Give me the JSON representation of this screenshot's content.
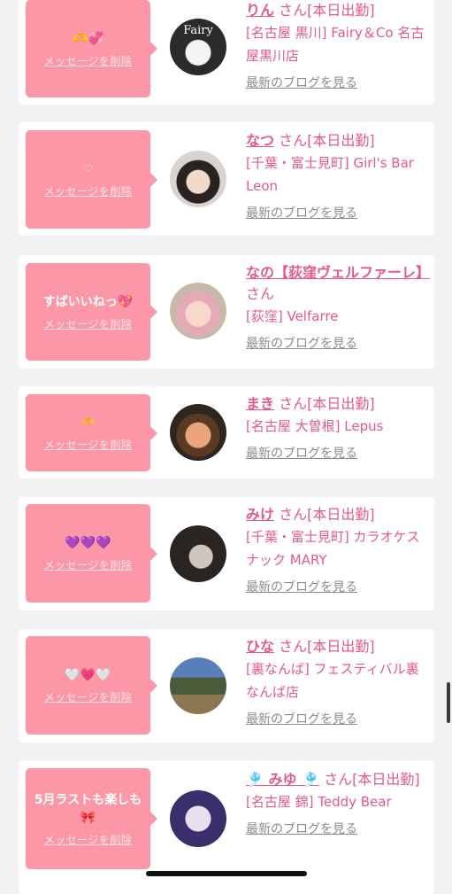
{
  "delete_label": "メッセージを削除",
  "blog_label": "最新のブログを見る",
  "san_label": "さん",
  "entries": [
    {
      "message": "🫶💞",
      "name": "りん",
      "status": "[本日出勤]",
      "shop": "[名古屋 黒川] Fairy＆Co 名古屋黒川店",
      "avatar_text": "Fairy"
    },
    {
      "message": "♡",
      "name": "なつ",
      "status": "[本日出勤]",
      "shop": "[千葉・富士見町] Girl's Bar Leon"
    },
    {
      "message": "すばいいねっ💖",
      "name": "なの【荻窪ヴェルファーレ】",
      "status": "",
      "shop": "[荻窪] Velfarre"
    },
    {
      "message": "🫶",
      "name": "まき",
      "status": "[本日出勤]",
      "shop": "[名古屋 大曽根] Lepus"
    },
    {
      "message": "💜💜💜",
      "name": "みけ",
      "status": "[本日出勤]",
      "shop": "[千葉・富士見町] カラオケスナック MARY"
    },
    {
      "message": "🤍💗🤍",
      "name": "ひな",
      "status": "[本日出勤]",
      "shop": "[裏なんば] フェスティバル裏なんば店"
    },
    {
      "message": "5月ラストも楽しも🎀",
      "name": "🎐 みゆ 🎐",
      "status": "[本日出勤]",
      "shop": "[名古屋 錦] Teddy Bear"
    }
  ]
}
